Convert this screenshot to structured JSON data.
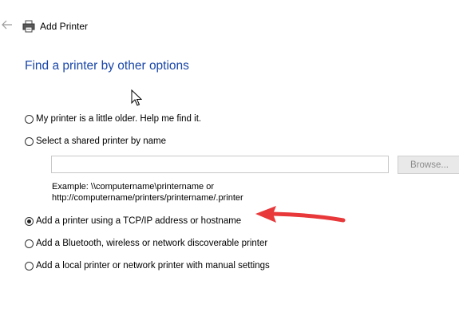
{
  "window": {
    "title": "Add Printer",
    "back_icon": "back-arrow-icon",
    "printer_icon": "printer-icon"
  },
  "heading": "Find a printer by other options",
  "options": [
    {
      "label": "My printer is a little older. Help me find it.",
      "checked": false
    },
    {
      "label": "Select a shared printer by name",
      "checked": false
    },
    {
      "label": "Add a printer using a TCP/IP address or hostname",
      "checked": true
    },
    {
      "label": "Add a Bluetooth, wireless or network discoverable printer",
      "checked": false
    },
    {
      "label": "Add a local printer or network printer with manual settings",
      "checked": false
    }
  ],
  "shared_printer": {
    "input_value": "",
    "browse_label": "Browse...",
    "example_line1": "Example: \\\\computername\\printername or",
    "example_line2": "http://computername/printers/printername/.printer"
  },
  "annotation": {
    "arrow_color": "#e8383a"
  },
  "colors": {
    "heading": "#1a47a8"
  }
}
